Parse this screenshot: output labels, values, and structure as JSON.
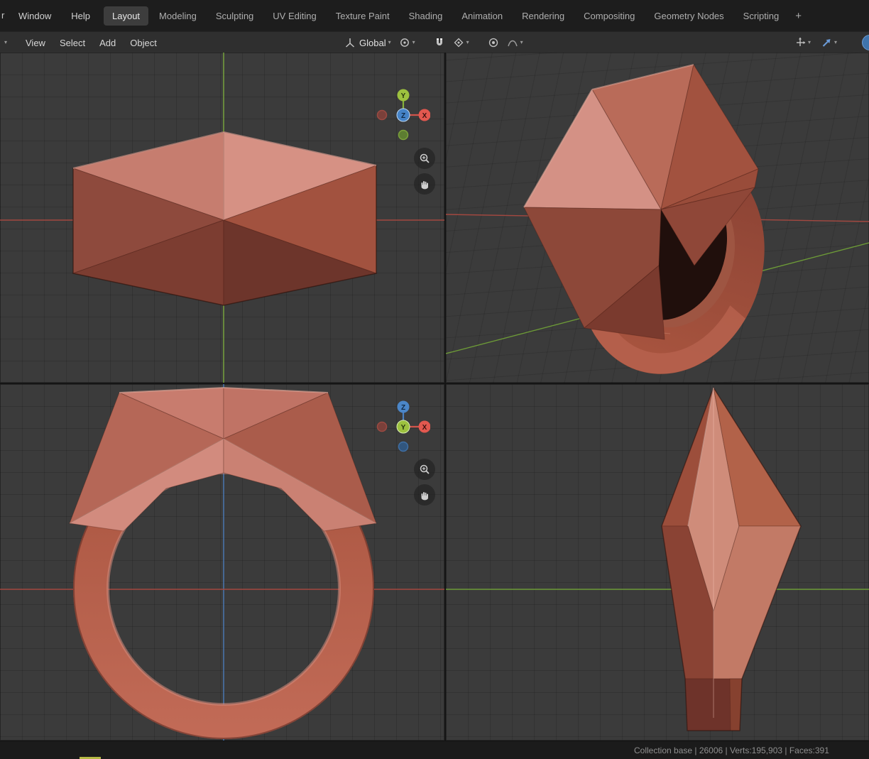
{
  "topbar": {
    "cut_menu_text": "r",
    "menus": [
      {
        "label": "Window"
      },
      {
        "label": "Help"
      }
    ],
    "tabs": [
      {
        "label": "Layout",
        "active": true
      },
      {
        "label": "Modeling"
      },
      {
        "label": "Sculpting"
      },
      {
        "label": "UV Editing"
      },
      {
        "label": "Texture Paint"
      },
      {
        "label": "Shading"
      },
      {
        "label": "Animation"
      },
      {
        "label": "Rendering"
      },
      {
        "label": "Compositing"
      },
      {
        "label": "Geometry Nodes"
      },
      {
        "label": "Scripting"
      }
    ],
    "new_tab_label": "+"
  },
  "toolbar": {
    "menus": [
      {
        "label": "View"
      },
      {
        "label": "Select"
      },
      {
        "label": "Add"
      },
      {
        "label": "Object"
      }
    ],
    "orientation_label": "Global",
    "icons": {
      "editor_type": "editor-type-dropdown",
      "transform_orientation": "transform-orientation-icon",
      "pivot_point": "pivot-point-icon",
      "snap_magnet": "magnet-icon",
      "snap_with": "snap-target-icon",
      "proportional_editing": "proportional-editing-icon",
      "falloff_curve": "falloff-curve-icon",
      "show_gizmos": "gizmos-icon",
      "overlays": "overlays-arrow-icon",
      "viewport_shading": "shading-sphere-icon"
    }
  },
  "glyphs": {
    "caret": "▾"
  },
  "viewport": {
    "gizmo": {
      "x": "X",
      "y": "Y",
      "z": "Z"
    }
  },
  "statusbar": {
    "text": "Collection base | 26006 | Verts:195,903 | Faces:391"
  },
  "colors": {
    "header_bg": "#1d1d1d",
    "toolbar_bg": "#2f2f2f",
    "viewport_bg": "#3b3b3b",
    "material_light": "#d69184",
    "material_mid": "#b05a47",
    "material_dark": "#6d352b",
    "axis_x_red": "#a34840",
    "axis_y_green": "#6d9b37",
    "axis_z_blue": "#4a7ab8",
    "gizmo_x": "#e2584f",
    "gizmo_y": "#9dc13f",
    "gizmo_z": "#4583c8",
    "active_blue": "#6b9bd8",
    "statusbar_text": "#8f8f8f"
  }
}
